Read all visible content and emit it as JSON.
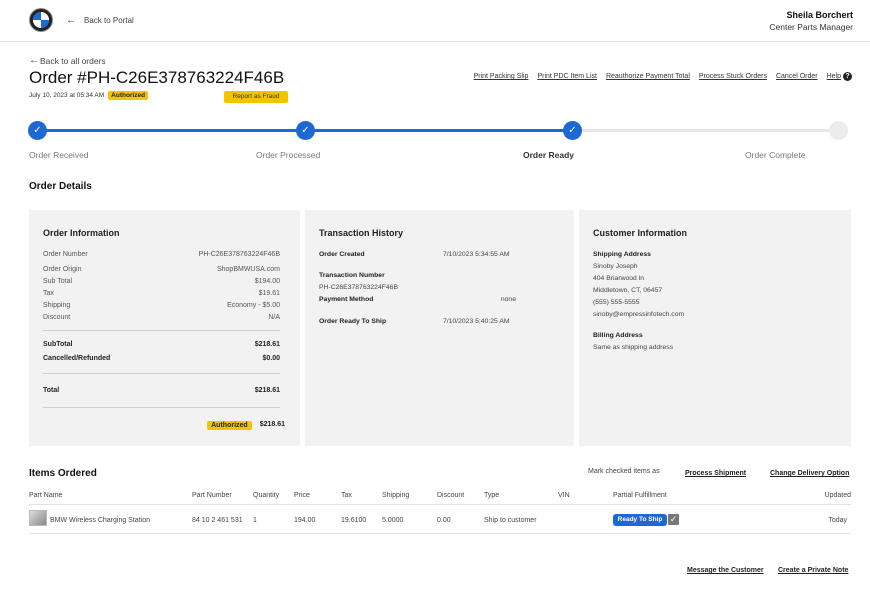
{
  "header": {
    "back_portal": "Back to Portal",
    "user_name": "Sheila Borchert",
    "user_role": "Center Parts Manager"
  },
  "order": {
    "back_orders": "Back to all orders",
    "title": "Order #PH-C26E378763224F46B",
    "date": "July 10, 2023 at 05:34 AM",
    "status_badge": "Authorized",
    "fraud_button": "Report as Fraud"
  },
  "actions": {
    "print_packing": "Print Packing Slip",
    "print_pdc": "Print PDC Item List",
    "reauthorize": "Reauthorize Payment Total",
    "process_stuck": "Process Stuck Orders",
    "cancel": "Cancel Order",
    "help": "Help"
  },
  "steps": [
    {
      "label": "Order Received"
    },
    {
      "label": "Order Processed"
    },
    {
      "label": "Order Ready"
    },
    {
      "label": "Order Complete"
    }
  ],
  "order_details_title": "Order Details",
  "order_info": {
    "title": "Order Information",
    "rows": [
      {
        "label": "Order Number",
        "value": "PH-C26E378763224F46B"
      },
      {
        "label": "Order Origin",
        "value": "ShopBMWUSA.com"
      },
      {
        "label": "Sub Total",
        "value": "$194.00"
      },
      {
        "label": "Tax",
        "value": "$19.61"
      },
      {
        "label": "Shipping",
        "value": "Economy - $5.00"
      },
      {
        "label": "Discount",
        "value": "N/A"
      }
    ],
    "subtotal_label": "SubTotal",
    "subtotal_value": "$218.61",
    "cancelled_label": "Cancelled/Refunded",
    "cancelled_value": "$0.00",
    "total_label": "Total",
    "total_value": "$218.61",
    "auth_badge": "Authorized",
    "auth_value": "$218.61"
  },
  "transaction": {
    "title": "Transaction History",
    "created_label": "Order Created",
    "created_value": "7/10/2023 5:34:55 AM",
    "txn_label": "Transaction Number",
    "txn_value": "PH-C26E378763224F46B",
    "payment_label": "Payment Method",
    "payment_value": "none",
    "ready_label": "Order Ready To Ship",
    "ready_value": "7/10/2023 5:40:25 AM"
  },
  "customer": {
    "title": "Customer Information",
    "shipping_label": "Shipping Address",
    "name": "Sinoby Joseph",
    "street": "404 Briarwood ln",
    "city": "Middletown, CT, 06457",
    "phone": "(555) 555-5555",
    "email": "sinoby@empressinfotech.com",
    "billing_label": "Billing Address",
    "billing_value": "Same as shipping address"
  },
  "items": {
    "title": "Items Ordered",
    "mark_text": "Mark checked items as",
    "process_shipment": "Process Shipment",
    "change_delivery": "Change Delivery Option",
    "headers": [
      "Part Name",
      "Part Number",
      "Quantity",
      "Price",
      "Tax",
      "Shipping",
      "Discount",
      "Type",
      "VIN",
      "Partial Fulfillment",
      "Updated"
    ],
    "row": {
      "name": "BMW Wireless Charging Station",
      "part_number": "84 10 2 461 531",
      "quantity": "1",
      "price": "194.00",
      "tax": "19.6100",
      "shipping": "5.0000",
      "discount": "0.00",
      "type": "Ship to customer",
      "vin": "",
      "status": "Ready To Ship",
      "updated": "Today"
    }
  },
  "footer": {
    "message": "Message the Customer",
    "note": "Create a Private Note"
  }
}
